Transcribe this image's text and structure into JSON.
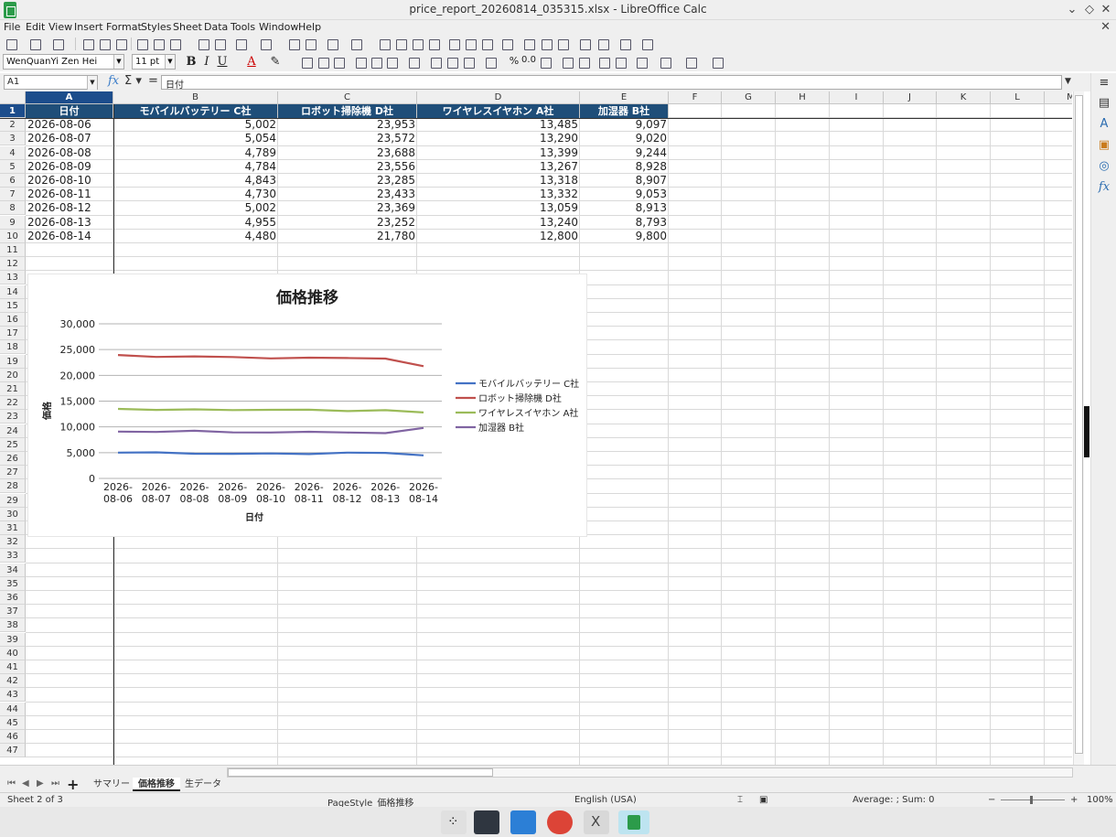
{
  "window": {
    "title": "price_report_20260814_035315.xlsx - LibreOffice Calc"
  },
  "menu": [
    "File",
    "Edit",
    "View",
    "Insert",
    "Format",
    "Styles",
    "Sheet",
    "Data",
    "Tools",
    "Window",
    "Help"
  ],
  "format": {
    "font_name": "WenQuanYi Zen Hei",
    "font_size": "11 pt"
  },
  "formula_bar": {
    "cell_ref": "A1",
    "content": "日付"
  },
  "columns": [
    "A",
    "B",
    "C",
    "D",
    "E",
    "F",
    "G",
    "H",
    "I",
    "J",
    "K",
    "L",
    "M"
  ],
  "rows": [
    "1",
    "2",
    "3",
    "4",
    "5",
    "6",
    "7",
    "8",
    "9",
    "10",
    "11",
    "12",
    "13",
    "14",
    "15",
    "16",
    "17",
    "18",
    "19",
    "20",
    "21",
    "22",
    "23",
    "24",
    "25",
    "26",
    "27",
    "28",
    "29",
    "30",
    "31",
    "32",
    "33",
    "34",
    "35",
    "36",
    "37",
    "38",
    "39",
    "40",
    "41",
    "42",
    "43",
    "44",
    "45",
    "46",
    "47"
  ],
  "table": {
    "headers": [
      "日付",
      "モバイルバッテリー C社",
      "ロボット掃除機 D社",
      "ワイヤレスイヤホン A社",
      "加湿器 B社"
    ],
    "rows": [
      [
        "2026-08-06",
        "5,002",
        "23,953",
        "13,485",
        "9,097"
      ],
      [
        "2026-08-07",
        "5,054",
        "23,572",
        "13,290",
        "9,020"
      ],
      [
        "2026-08-08",
        "4,789",
        "23,688",
        "13,399",
        "9,244"
      ],
      [
        "2026-08-09",
        "4,784",
        "23,556",
        "13,267",
        "8,928"
      ],
      [
        "2026-08-10",
        "4,843",
        "23,285",
        "13,318",
        "8,907"
      ],
      [
        "2026-08-11",
        "4,730",
        "23,433",
        "13,332",
        "9,053"
      ],
      [
        "2026-08-12",
        "5,002",
        "23,369",
        "13,059",
        "8,913"
      ],
      [
        "2026-08-13",
        "4,955",
        "23,252",
        "13,240",
        "8,793"
      ],
      [
        "2026-08-14",
        "4,480",
        "21,780",
        "12,800",
        "9,800"
      ]
    ]
  },
  "chart_data": {
    "type": "line",
    "title": "価格推移",
    "xlabel": "日付",
    "ylabel": "価格",
    "ylim": [
      0,
      30000
    ],
    "yticks": [
      "30,000",
      "25,000",
      "20,000",
      "15,000",
      "10,000",
      "5,000",
      "0"
    ],
    "categories": [
      "2026-08-06",
      "2026-08-07",
      "2026-08-08",
      "2026-08-09",
      "2026-08-10",
      "2026-08-11",
      "2026-08-12",
      "2026-08-13",
      "2026-08-14"
    ],
    "series": [
      {
        "name": "モバイルバッテリー C社",
        "color": "#4472c4",
        "values": [
          5002,
          5054,
          4789,
          4784,
          4843,
          4730,
          5002,
          4955,
          4480
        ]
      },
      {
        "name": "ロボット掃除機 D社",
        "color": "#c0504d",
        "values": [
          23953,
          23572,
          23688,
          23556,
          23285,
          23433,
          23369,
          23252,
          21780
        ]
      },
      {
        "name": "ワイヤレスイヤホン A社",
        "color": "#9bbb59",
        "values": [
          13485,
          13290,
          13399,
          13267,
          13318,
          13332,
          13059,
          13240,
          12800
        ]
      },
      {
        "name": "加湿器 B社",
        "color": "#8064a2",
        "values": [
          9097,
          9020,
          9244,
          8928,
          8907,
          9053,
          8913,
          8793,
          9800
        ]
      }
    ],
    "grid": true,
    "legend": "right"
  },
  "sheet_tabs": [
    "サマリー",
    "価格推移",
    "生データ"
  ],
  "status": {
    "sheet": "Sheet 2 of 3",
    "page_style": "PageStyle_価格推移",
    "language": "English (USA)",
    "summary": "Average: ; Sum: 0",
    "zoom": "100%"
  },
  "colors": {
    "header_bg": "#1f4e79",
    "selection": "#1c4d8c"
  }
}
